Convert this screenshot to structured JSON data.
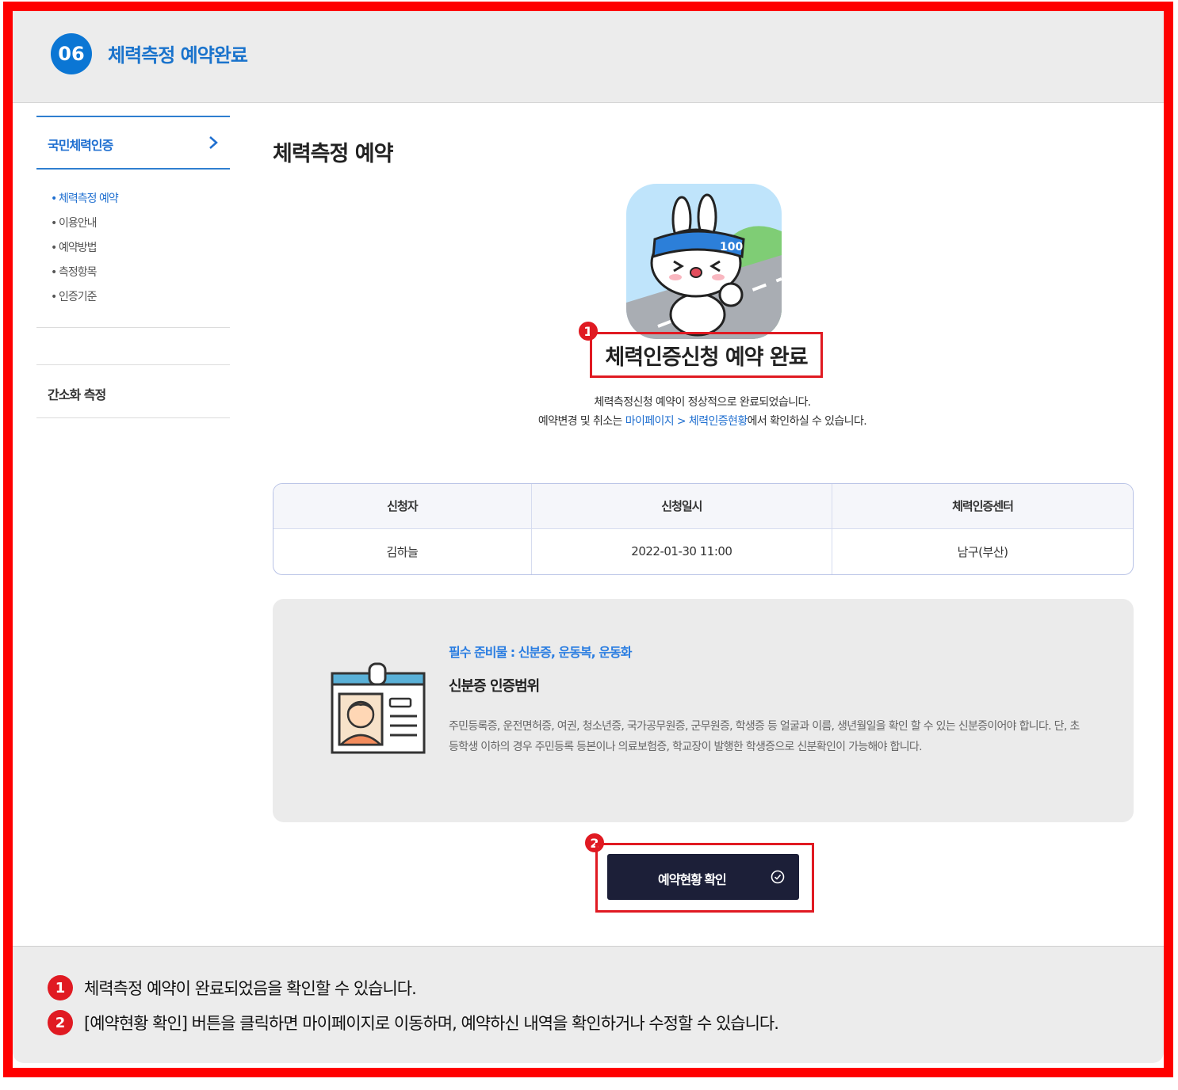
{
  "header": {
    "step_number": "06",
    "step_title": "체력측정 예약완료"
  },
  "sidebar": {
    "main_label": "국민체력인증",
    "items": [
      {
        "label": "체력측정 예약",
        "active": true
      },
      {
        "label": "이용안내",
        "active": false
      },
      {
        "label": "예약방법",
        "active": false
      },
      {
        "label": "측정항목",
        "active": false
      },
      {
        "label": "인증기준",
        "active": false
      }
    ],
    "other_label": "간소화 측정",
    "bullet": "•"
  },
  "main": {
    "page_title": "체력측정 예약",
    "mascot_icon": "running-rabbit-mascot",
    "mascot_headband_text": "100",
    "callout_1": "1",
    "callout_2": "2",
    "done_title": "체력인증신청 예약 완료",
    "done_line1": "체력측정신청 예약이 정상적으로 완료되었습니다.",
    "done_line2_prefix": "예약변경 및 취소는 ",
    "done_line2_link": "마이페이지 > 체력인증현황",
    "done_line2_suffix": "에서 확인하실 수 있습니다."
  },
  "table": {
    "headers": [
      "신청자",
      "신청일시",
      "체력인증센터"
    ],
    "row": [
      "김하늘",
      "2022-01-30 11:00",
      "남구(부산)"
    ]
  },
  "prep": {
    "required": "필수 준비물 : 신분증, 운동복, 운동화",
    "subtitle": "신분증 인증범위",
    "body": "주민등록증, 운전면허증, 여권, 청소년증, 국가공무원증, 군무원증, 학생증 등 얼굴과 이름, 생년월일을 확인 할 수 있는 신분증이어야 합니다. 단, 초등학생 이하의 경우 주민등록 등본이나 의료보험증, 학교장이 발행한 학생증으로 신분확인이 가능해야 합니다."
  },
  "button": {
    "label": "예약현황 확인",
    "icon": "check-circle-icon"
  },
  "notes": [
    {
      "num": "1",
      "text": "체력측정 예약이 완료되었음을 확인할 수 있습니다."
    },
    {
      "num": "2",
      "text": "[예약현황 확인] 버튼을 클릭하면 마이페이지로 이동하며, 예약하신 내역을 확인하거나 수정할 수 있습니다."
    }
  ],
  "colors": {
    "accent_blue": "#0b76d4",
    "callout_red": "#e01a22",
    "button_navy": "#1c1f38"
  }
}
